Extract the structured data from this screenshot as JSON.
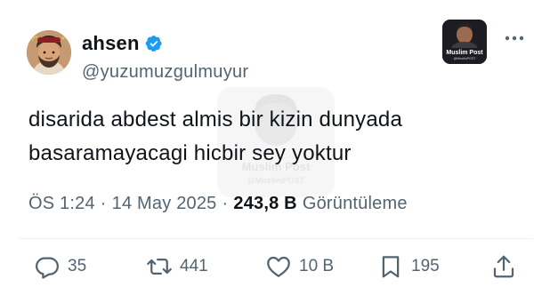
{
  "author": {
    "display_name": "ahsen",
    "handle": "@yuzumuzgulmuyur",
    "verified": true,
    "verified_color": "#1d9bf0"
  },
  "logo_badge": {
    "title": "Muslim Post",
    "subtitle": "@MuslimPOST"
  },
  "tweet": {
    "lines": [
      "disarida abdest almis bir kizin dunyada",
      "basaramayacagi hicbir sey yoktur"
    ]
  },
  "watermark": {
    "title": "Muslim Post",
    "subtitle": "@MuslimPOST"
  },
  "meta": {
    "time": "ÖS 1:24",
    "separator": "·",
    "date": "14 May 2025",
    "views_count": "243,8 B",
    "views_label": "Görüntüleme"
  },
  "actions": {
    "replies": "35",
    "reposts": "441",
    "likes": "10 B",
    "bookmarks": "195"
  },
  "icons": {
    "more": "more-horizontal-icon",
    "reply": "reply-icon",
    "repost": "repost-icon",
    "like": "heart-icon",
    "bookmark": "bookmark-icon",
    "share": "share-icon"
  },
  "colors": {
    "text": "#0f1419",
    "secondary": "#536471",
    "accent": "#1d9bf0"
  }
}
